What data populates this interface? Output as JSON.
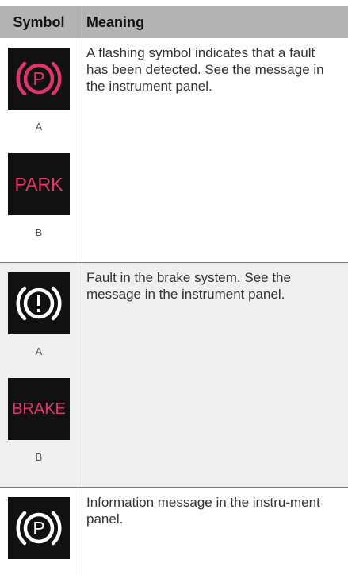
{
  "table": {
    "headers": {
      "symbol": "Symbol",
      "meaning": "Meaning"
    },
    "rows": [
      {
        "meaning": "A flashing symbol indicates that a fault has been detected. See the message in the instrument panel.",
        "icons": [
          {
            "icon": "parking-brake-p-icon",
            "color": "#e0356a",
            "label": "A"
          },
          {
            "icon": "park-text-icon",
            "text": "PARK",
            "color": "#e0356a",
            "label": "B"
          }
        ]
      },
      {
        "meaning": "Fault in the brake system. See the message in the instrument panel.",
        "icons": [
          {
            "icon": "brake-warning-exclamation-icon",
            "color": "#ffffff",
            "label": "A"
          },
          {
            "icon": "brake-text-icon",
            "text": "BRAKE",
            "color": "#e0356a",
            "label": "B"
          }
        ]
      },
      {
        "meaning": "Information message in the instru-ment panel.",
        "icons": [
          {
            "icon": "parking-brake-p-icon",
            "color": "#ffffff"
          }
        ]
      }
    ]
  }
}
